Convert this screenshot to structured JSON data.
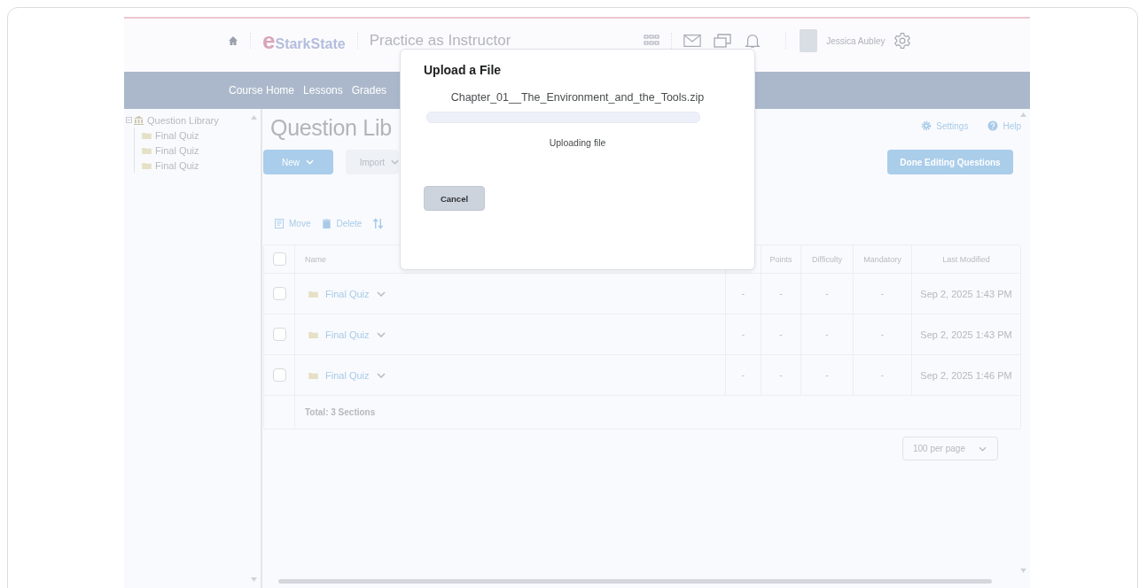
{
  "header": {
    "logo": {
      "mark": "e",
      "name": "StarkState"
    },
    "course_title": "Practice as Instructor",
    "user_name": "Jessica Aubley"
  },
  "nav": {
    "items": [
      "Course Home",
      "Lessons",
      "Grades"
    ]
  },
  "sidebar": {
    "tree": [
      {
        "label": "Question Library",
        "expanded": true,
        "children": [
          {
            "label": "Final Quiz"
          },
          {
            "label": "Final Quiz"
          },
          {
            "label": "Final Quiz"
          }
        ]
      }
    ]
  },
  "main": {
    "title": "Question Lib",
    "new_button": "New",
    "import_button": "Import",
    "settings": "Settings",
    "help": "Help",
    "done_button": "Done Editing Questions",
    "toolbar": [
      {
        "kind": "move",
        "label": "Move"
      },
      {
        "kind": "delete",
        "label": "Delete"
      },
      {
        "kind": "sort"
      }
    ],
    "table": {
      "all_selected": false,
      "columns": [
        "Name",
        "",
        "Points",
        "Difficulty",
        "Mandatory",
        "Last Modified"
      ],
      "rows": [
        {
          "selected": false,
          "cells": [
            "Final Quiz",
            "-",
            "-",
            "-",
            "-",
            "Sep 2, 2025 1:43 PM"
          ]
        },
        {
          "selected": false,
          "cells": [
            "Final Quiz",
            "-",
            "-",
            "-",
            "-",
            "Sep 2, 2025 1:43 PM"
          ]
        },
        {
          "selected": false,
          "cells": [
            "Final Quiz",
            "-",
            "-",
            "-",
            "-",
            "Sep 2, 2025 1:46 PM"
          ]
        }
      ],
      "total": "Total:  3 Sections"
    },
    "per_page": "100 per page"
  },
  "dialog": {
    "title": "Upload a File",
    "file_name": "Chapter_01__The_Environment_and_the_Tools.zip",
    "progress": {
      "level": 0
    },
    "status": "Uploading file",
    "cancel_button": "Cancel"
  }
}
